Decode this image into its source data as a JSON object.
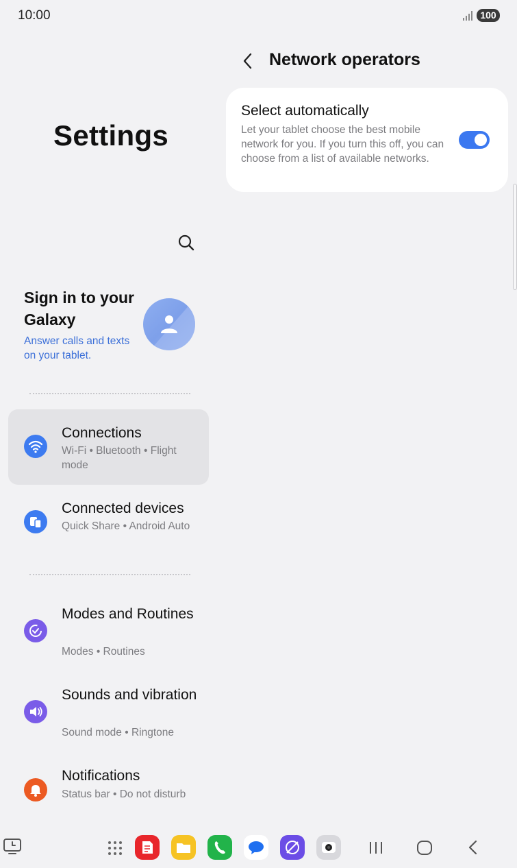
{
  "status_bar": {
    "time": "10:00",
    "battery": "100",
    "signal_icon": "signal-strength-icon"
  },
  "settings": {
    "title": "Settings",
    "search_icon": "search-icon",
    "account": {
      "title": "Sign in to your Galaxy",
      "subtitle": "Answer calls and texts on your tablet.",
      "avatar_icon": "person-icon"
    },
    "items": [
      {
        "title": "Connections",
        "subtitle": "Wi-Fi  •  Bluetooth  •  Flight mode",
        "icon": "wifi-icon",
        "color": "#3d7bf0",
        "selected": true
      },
      {
        "title": "Connected devices",
        "subtitle": "Quick Share  •  Android Auto",
        "icon": "connected-devices-icon",
        "color": "#3d7bf0"
      },
      {
        "title": "Modes and Routines",
        "subtitle": "Modes  •  Routines",
        "icon": "routines-icon",
        "color": "#7a5ce8"
      },
      {
        "title": "Sounds and vibration",
        "subtitle": "Sound mode  •  Ringtone",
        "icon": "speaker-icon",
        "color": "#7a5ce8"
      },
      {
        "title": "Notifications",
        "subtitle": "Status bar  •  Do not disturb",
        "icon": "bell-icon",
        "color": "#ec5a22"
      }
    ]
  },
  "network_operators": {
    "title": "Network operators",
    "back_icon": "back-arrow-icon",
    "select_automatically": {
      "title": "Select automatically",
      "description": "Let your tablet choose the best mobile network for you. If you turn this off, you can choose from a list of available networks.",
      "enabled": true
    }
  },
  "taskbar": {
    "apps": [
      {
        "name": "taskbar-recent-icon"
      },
      {
        "name": "app-drawer-icon"
      },
      {
        "name": "samsung-notes-app-icon",
        "color": "#e8262b"
      },
      {
        "name": "my-files-app-icon",
        "color": "#f6c324"
      },
      {
        "name": "phone-app-icon",
        "color": "#22b34a"
      },
      {
        "name": "messages-app-icon",
        "color": "#1f6ff0"
      },
      {
        "name": "internet-app-icon",
        "color": "#6b4de6"
      },
      {
        "name": "camera-app-icon",
        "color": "#d8d8dc"
      }
    ],
    "nav": [
      "recents-nav-icon",
      "home-nav-icon",
      "back-nav-icon"
    ]
  },
  "colors": {
    "accent": "#3b78f0",
    "link": "#3b6fd8",
    "background": "#f2f2f4"
  }
}
